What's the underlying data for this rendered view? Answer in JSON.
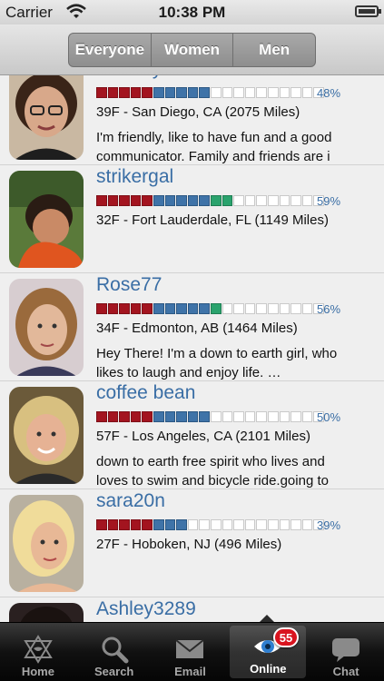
{
  "status_bar": {
    "carrier": "Carrier",
    "time": "10:38 PM"
  },
  "segments": [
    "Everyone",
    "Women",
    "Men"
  ],
  "profiles": [
    {
      "username": "reiklady",
      "percent": "48%",
      "match": 0.48,
      "meta": "39F - San Diego, CA (2075 Miles)",
      "bio": "I'm friendly, like to have fun and a good\ncommunicator. Family and friends are i"
    },
    {
      "username": "strikergal",
      "percent": "59%",
      "match": 0.59,
      "meta": "32F - Fort Lauderdale, FL (1149 Miles)",
      "bio": ""
    },
    {
      "username": "Rose77",
      "percent": "56%",
      "match": 0.56,
      "meta": "34F - Edmonton, AB (1464 Miles)",
      "bio": "Hey There! I'm a down to earth girl, who\nlikes to laugh and enjoy life. …"
    },
    {
      "username": "coffee bean",
      "percent": "50%",
      "match": 0.5,
      "meta": "57F - Los Angeles, CA (2101 Miles)",
      "bio": "down to earth free spirit who lives and\nloves to swim and bicycle ride.going to"
    },
    {
      "username": "sara20n",
      "percent": "39%",
      "match": 0.39,
      "meta": "27F - Hoboken, NJ (496 Miles)",
      "bio": ""
    },
    {
      "username": "Ashley3289",
      "percent": "",
      "match": 0,
      "meta": "",
      "bio": ""
    }
  ],
  "tabs": [
    {
      "label": "Home",
      "icon": "star-of-david-icon"
    },
    {
      "label": "Search",
      "icon": "magnifier-icon"
    },
    {
      "label": "Email",
      "icon": "envelope-icon"
    },
    {
      "label": "Online",
      "icon": "eye-icon",
      "badge": "55"
    },
    {
      "label": "Chat",
      "icon": "speech-bubble-icon"
    }
  ]
}
